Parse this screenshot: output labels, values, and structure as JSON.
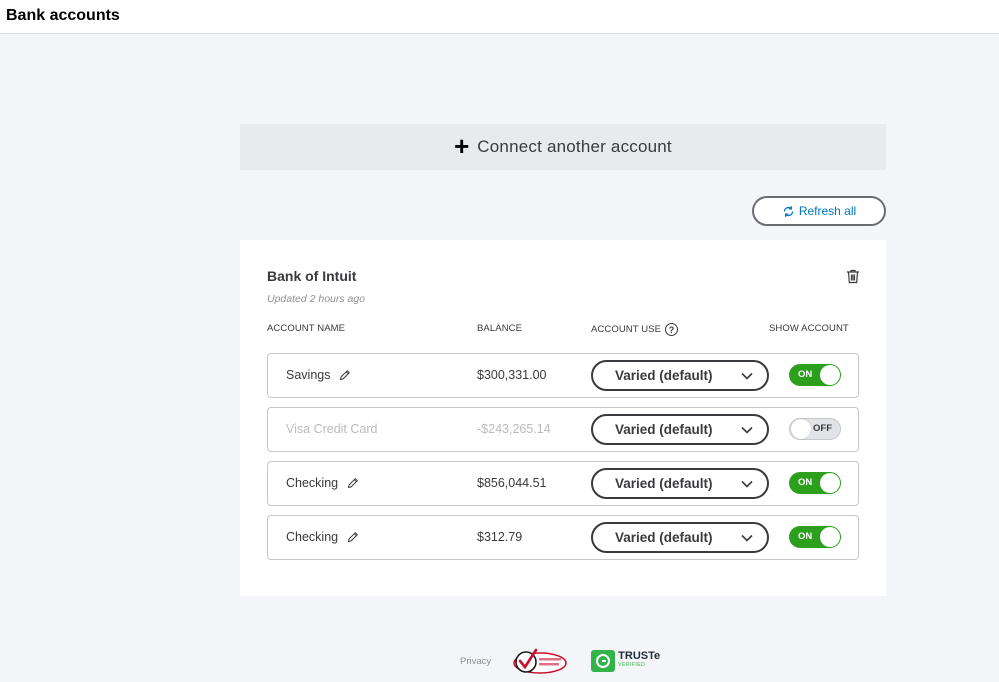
{
  "header": {
    "title": "Bank accounts"
  },
  "connect_button": {
    "icon": "plus-icon",
    "label": "Connect another account"
  },
  "refresh_button": {
    "icon": "refresh-icon",
    "label": "Refresh all"
  },
  "bank": {
    "name": "Bank of Intuit",
    "updated": "Updated 2 hours ago",
    "columns": {
      "name": "ACCOUNT NAME",
      "balance": "BALANCE",
      "use": "ACCOUNT USE",
      "show": "SHOW ACCOUNT"
    },
    "accounts": [
      {
        "name": "Savings",
        "balance": "$300,331.00",
        "use": "Varied (default)",
        "show": "ON",
        "enabled": true
      },
      {
        "name": "Visa Credit Card",
        "balance": "-$243,265.14",
        "use": "Varied (default)",
        "show": "OFF",
        "enabled": false
      },
      {
        "name": "Checking",
        "balance": "$856,044.51",
        "use": "Varied (default)",
        "show": "ON",
        "enabled": true
      },
      {
        "name": "Checking",
        "balance": "$312.79",
        "use": "Varied (default)",
        "show": "ON",
        "enabled": true
      }
    ]
  },
  "footer": {
    "privacy": "Privacy",
    "verisign": "VeriSign Secured",
    "truste_name": "TRUSTe",
    "truste_sub": "VERIFIED"
  },
  "colors": {
    "toggle_on": "#2ca01c",
    "link": "#0077c5",
    "truste": "#32b449",
    "verisign": "#c8102e"
  }
}
